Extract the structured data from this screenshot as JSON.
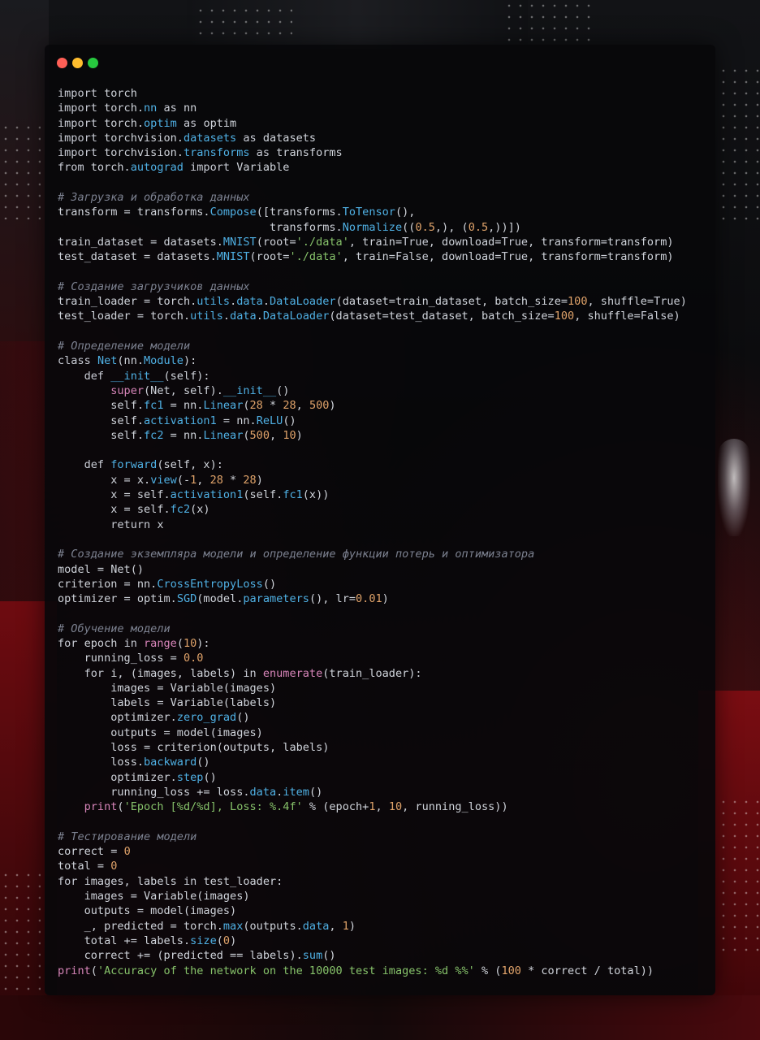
{
  "window": {
    "controls": [
      {
        "name": "close",
        "color": "#ff5f56"
      },
      {
        "name": "minimize",
        "color": "#ffbd2e"
      },
      {
        "name": "maximize",
        "color": "#27c93f"
      }
    ]
  },
  "code": {
    "lines": [
      [
        [
          "kw",
          "import "
        ],
        [
          "plain",
          "torch"
        ]
      ],
      [
        [
          "kw",
          "import "
        ],
        [
          "plain",
          "torch."
        ],
        [
          "attr",
          "nn"
        ],
        [
          "kw",
          " as "
        ],
        [
          "plain",
          "nn"
        ]
      ],
      [
        [
          "kw",
          "import "
        ],
        [
          "plain",
          "torch."
        ],
        [
          "attr",
          "optim"
        ],
        [
          "kw",
          " as "
        ],
        [
          "plain",
          "optim"
        ]
      ],
      [
        [
          "kw",
          "import "
        ],
        [
          "plain",
          "torchvision."
        ],
        [
          "attr",
          "datasets"
        ],
        [
          "kw",
          " as "
        ],
        [
          "plain",
          "datasets"
        ]
      ],
      [
        [
          "kw",
          "import "
        ],
        [
          "plain",
          "torchvision."
        ],
        [
          "attr",
          "transforms"
        ],
        [
          "kw",
          " as "
        ],
        [
          "plain",
          "transforms"
        ]
      ],
      [
        [
          "kw",
          "from "
        ],
        [
          "plain",
          "torch."
        ],
        [
          "attr",
          "autograd"
        ],
        [
          "kw",
          " import "
        ],
        [
          "plain",
          "Variable"
        ]
      ],
      [],
      [
        [
          "cm",
          "# Загрузка и обработка данных"
        ]
      ],
      [
        [
          "plain",
          "transform = transforms."
        ],
        [
          "func",
          "Compose"
        ],
        [
          "plain",
          "([transforms."
        ],
        [
          "func",
          "ToTensor"
        ],
        [
          "plain",
          "(),"
        ]
      ],
      [
        [
          "plain",
          "                                transforms."
        ],
        [
          "func",
          "Normalize"
        ],
        [
          "plain",
          "(("
        ],
        [
          "num",
          "0.5"
        ],
        [
          "plain",
          ",), ("
        ],
        [
          "num",
          "0.5"
        ],
        [
          "plain",
          ",))])"
        ]
      ],
      [
        [
          "plain",
          "train_dataset = datasets."
        ],
        [
          "func",
          "MNIST"
        ],
        [
          "plain",
          "(root="
        ],
        [
          "str",
          "'./data'"
        ],
        [
          "plain",
          ", train="
        ],
        [
          "kw",
          "True"
        ],
        [
          "plain",
          ", download="
        ],
        [
          "kw",
          "True"
        ],
        [
          "plain",
          ", transform=transform)"
        ]
      ],
      [
        [
          "plain",
          "test_dataset = datasets."
        ],
        [
          "func",
          "MNIST"
        ],
        [
          "plain",
          "(root="
        ],
        [
          "str",
          "'./data'"
        ],
        [
          "plain",
          ", train="
        ],
        [
          "kw",
          "False"
        ],
        [
          "plain",
          ", download="
        ],
        [
          "kw",
          "True"
        ],
        [
          "plain",
          ", transform=transform)"
        ]
      ],
      [],
      [
        [
          "cm",
          "# Создание загрузчиков данных"
        ]
      ],
      [
        [
          "plain",
          "train_loader = torch."
        ],
        [
          "attr",
          "utils"
        ],
        [
          "plain",
          "."
        ],
        [
          "attr",
          "data"
        ],
        [
          "plain",
          "."
        ],
        [
          "func",
          "DataLoader"
        ],
        [
          "plain",
          "(dataset=train_dataset, batch_size="
        ],
        [
          "num",
          "100"
        ],
        [
          "plain",
          ", shuffle="
        ],
        [
          "kw",
          "True"
        ],
        [
          "plain",
          ")"
        ]
      ],
      [
        [
          "plain",
          "test_loader = torch."
        ],
        [
          "attr",
          "utils"
        ],
        [
          "plain",
          "."
        ],
        [
          "attr",
          "data"
        ],
        [
          "plain",
          "."
        ],
        [
          "func",
          "DataLoader"
        ],
        [
          "plain",
          "(dataset=test_dataset, batch_size="
        ],
        [
          "num",
          "100"
        ],
        [
          "plain",
          ", shuffle="
        ],
        [
          "kw",
          "False"
        ],
        [
          "plain",
          ")"
        ]
      ],
      [],
      [
        [
          "cm",
          "# Определение модели"
        ]
      ],
      [
        [
          "kw",
          "class "
        ],
        [
          "func",
          "Net"
        ],
        [
          "plain",
          "(nn."
        ],
        [
          "func",
          "Module"
        ],
        [
          "plain",
          "):"
        ]
      ],
      [
        [
          "kw",
          "    def "
        ],
        [
          "func",
          "__init__"
        ],
        [
          "plain",
          "(self):"
        ]
      ],
      [
        [
          "builtin",
          "        super"
        ],
        [
          "plain",
          "(Net, self)."
        ],
        [
          "func",
          "__init__"
        ],
        [
          "plain",
          "()"
        ]
      ],
      [
        [
          "plain",
          "        self."
        ],
        [
          "attr",
          "fc1"
        ],
        [
          "plain",
          " = nn."
        ],
        [
          "func",
          "Linear"
        ],
        [
          "plain",
          "("
        ],
        [
          "num",
          "28"
        ],
        [
          "plain",
          " * "
        ],
        [
          "num",
          "28"
        ],
        [
          "plain",
          ", "
        ],
        [
          "num",
          "500"
        ],
        [
          "plain",
          ")"
        ]
      ],
      [
        [
          "plain",
          "        self."
        ],
        [
          "attr",
          "activation1"
        ],
        [
          "plain",
          " = nn."
        ],
        [
          "func",
          "ReLU"
        ],
        [
          "plain",
          "()"
        ]
      ],
      [
        [
          "plain",
          "        self."
        ],
        [
          "attr",
          "fc2"
        ],
        [
          "plain",
          " = nn."
        ],
        [
          "func",
          "Linear"
        ],
        [
          "plain",
          "("
        ],
        [
          "num",
          "500"
        ],
        [
          "plain",
          ", "
        ],
        [
          "num",
          "10"
        ],
        [
          "plain",
          ")"
        ]
      ],
      [],
      [
        [
          "kw",
          "    def "
        ],
        [
          "func",
          "forward"
        ],
        [
          "plain",
          "(self, x):"
        ]
      ],
      [
        [
          "plain",
          "        x = x."
        ],
        [
          "func",
          "view"
        ],
        [
          "plain",
          "(-"
        ],
        [
          "num",
          "1"
        ],
        [
          "plain",
          ", "
        ],
        [
          "num",
          "28"
        ],
        [
          "plain",
          " * "
        ],
        [
          "num",
          "28"
        ],
        [
          "plain",
          ")"
        ]
      ],
      [
        [
          "plain",
          "        x = self."
        ],
        [
          "attr",
          "activation1"
        ],
        [
          "plain",
          "(self."
        ],
        [
          "attr",
          "fc1"
        ],
        [
          "plain",
          "(x))"
        ]
      ],
      [
        [
          "plain",
          "        x = self."
        ],
        [
          "attr",
          "fc2"
        ],
        [
          "plain",
          "(x)"
        ]
      ],
      [
        [
          "kw",
          "        return "
        ],
        [
          "plain",
          "x"
        ]
      ],
      [],
      [
        [
          "cm",
          "# Создание экземпляра модели и определение функции потерь и оптимизатора"
        ]
      ],
      [
        [
          "plain",
          "model = Net()"
        ]
      ],
      [
        [
          "plain",
          "criterion = nn."
        ],
        [
          "func",
          "CrossEntropyLoss"
        ],
        [
          "plain",
          "()"
        ]
      ],
      [
        [
          "plain",
          "optimizer = optim."
        ],
        [
          "func",
          "SGD"
        ],
        [
          "plain",
          "(model."
        ],
        [
          "func",
          "parameters"
        ],
        [
          "plain",
          "(), lr="
        ],
        [
          "num",
          "0.01"
        ],
        [
          "plain",
          ")"
        ]
      ],
      [],
      [
        [
          "cm",
          "# Обучение модели"
        ]
      ],
      [
        [
          "kw",
          "for "
        ],
        [
          "plain",
          "epoch "
        ],
        [
          "kw",
          "in "
        ],
        [
          "builtin",
          "range"
        ],
        [
          "plain",
          "("
        ],
        [
          "num",
          "10"
        ],
        [
          "plain",
          "):"
        ]
      ],
      [
        [
          "plain",
          "    running_loss = "
        ],
        [
          "num",
          "0.0"
        ]
      ],
      [
        [
          "kw",
          "    for "
        ],
        [
          "plain",
          "i, (images, labels) "
        ],
        [
          "kw",
          "in "
        ],
        [
          "builtin",
          "enumerate"
        ],
        [
          "plain",
          "(train_loader):"
        ]
      ],
      [
        [
          "plain",
          "        images = Variable(images)"
        ]
      ],
      [
        [
          "plain",
          "        labels = Variable(labels)"
        ]
      ],
      [
        [
          "plain",
          "        optimizer."
        ],
        [
          "func",
          "zero_grad"
        ],
        [
          "plain",
          "()"
        ]
      ],
      [
        [
          "plain",
          "        outputs = model(images)"
        ]
      ],
      [
        [
          "plain",
          "        loss = criterion(outputs, labels)"
        ]
      ],
      [
        [
          "plain",
          "        loss."
        ],
        [
          "func",
          "backward"
        ],
        [
          "plain",
          "()"
        ]
      ],
      [
        [
          "plain",
          "        optimizer."
        ],
        [
          "func",
          "step"
        ],
        [
          "plain",
          "()"
        ]
      ],
      [
        [
          "plain",
          "        running_loss += loss."
        ],
        [
          "attr",
          "data"
        ],
        [
          "plain",
          "."
        ],
        [
          "func",
          "item"
        ],
        [
          "plain",
          "()"
        ]
      ],
      [
        [
          "builtin",
          "    print"
        ],
        [
          "plain",
          "("
        ],
        [
          "str",
          "'Epoch [%d/%d], Loss: %.4f'"
        ],
        [
          "plain",
          " % (epoch+"
        ],
        [
          "num",
          "1"
        ],
        [
          "plain",
          ", "
        ],
        [
          "num",
          "10"
        ],
        [
          "plain",
          ", running_loss))"
        ]
      ],
      [],
      [
        [
          "cm",
          "# Тестирование модели"
        ]
      ],
      [
        [
          "plain",
          "correct = "
        ],
        [
          "num",
          "0"
        ]
      ],
      [
        [
          "plain",
          "total = "
        ],
        [
          "num",
          "0"
        ]
      ],
      [
        [
          "kw",
          "for "
        ],
        [
          "plain",
          "images, labels "
        ],
        [
          "kw",
          "in "
        ],
        [
          "plain",
          "test_loader:"
        ]
      ],
      [
        [
          "plain",
          "    images = Variable(images)"
        ]
      ],
      [
        [
          "plain",
          "    outputs = model(images)"
        ]
      ],
      [
        [
          "plain",
          "    _, predicted = torch."
        ],
        [
          "func",
          "max"
        ],
        [
          "plain",
          "(outputs."
        ],
        [
          "attr",
          "data"
        ],
        [
          "plain",
          ", "
        ],
        [
          "num",
          "1"
        ],
        [
          "plain",
          ")"
        ]
      ],
      [
        [
          "plain",
          "    total += labels."
        ],
        [
          "func",
          "size"
        ],
        [
          "plain",
          "("
        ],
        [
          "num",
          "0"
        ],
        [
          "plain",
          ")"
        ]
      ],
      [
        [
          "plain",
          "    correct += (predicted == labels)."
        ],
        [
          "func",
          "sum"
        ],
        [
          "plain",
          "()"
        ]
      ],
      [
        [
          "builtin",
          "print"
        ],
        [
          "plain",
          "("
        ],
        [
          "str",
          "'Accuracy of the network on the 10000 test images: %d %%'"
        ],
        [
          "plain",
          " % ("
        ],
        [
          "num",
          "100"
        ],
        [
          "plain",
          " * correct / total))"
        ]
      ]
    ]
  }
}
